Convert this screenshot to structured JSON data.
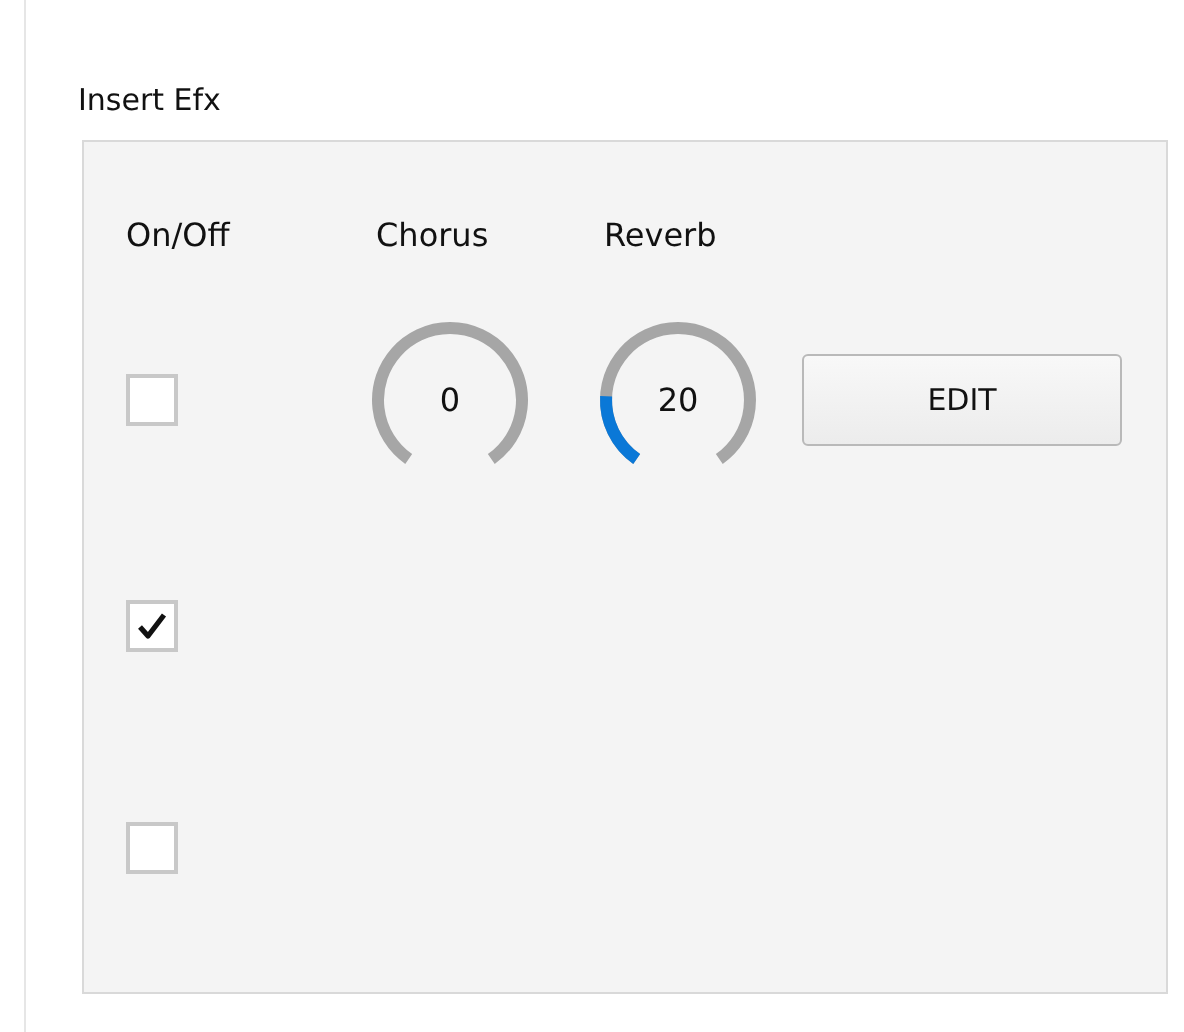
{
  "group": {
    "title": "Insert Efx"
  },
  "columns": [
    "On/Off",
    "Chorus",
    "Reverb"
  ],
  "rows": [
    {
      "checked": false,
      "knobs": [
        {
          "value": "0"
        },
        {
          "value": "20"
        }
      ],
      "button": "EDIT"
    },
    {
      "checked": true
    },
    {
      "checked": false
    }
  ]
}
